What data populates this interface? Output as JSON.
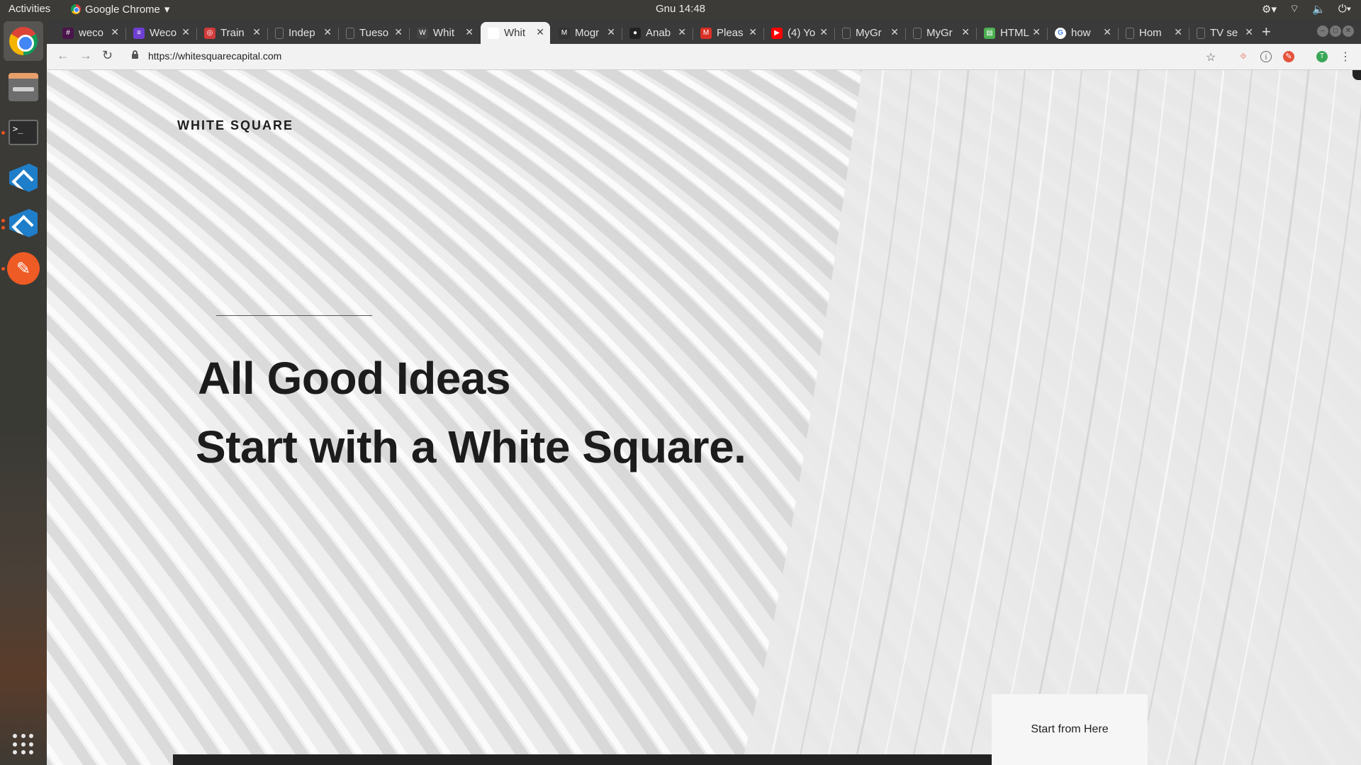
{
  "topbar": {
    "activities": "Activities",
    "app_name": "Google Chrome",
    "clock": "Gnu 14:48"
  },
  "dock": {
    "items": [
      "chrome",
      "files",
      "terminal",
      "vscode",
      "vscode",
      "postman"
    ]
  },
  "tabs": [
    {
      "title": "weco",
      "favicon": "slack",
      "color": "#4a154b"
    },
    {
      "title": "Weco",
      "favicon": "list",
      "color": "#6e3fd0"
    },
    {
      "title": "Train",
      "favicon": "pin",
      "color": "#d23b3b"
    },
    {
      "title": "Indep",
      "favicon": "blank",
      "color": "#555555"
    },
    {
      "title": "Tueso",
      "favicon": "blank",
      "color": "#555555"
    },
    {
      "title": "Whit",
      "favicon": "w",
      "color": "#444444"
    },
    {
      "title": "Whit",
      "favicon": "blank-white",
      "color": "#ffffff",
      "active": true
    },
    {
      "title": "Mogr",
      "favicon": "m",
      "color": "#333333"
    },
    {
      "title": "Anab",
      "favicon": "github",
      "color": "#222222"
    },
    {
      "title": "Pleas",
      "favicon": "gmail",
      "color": "#d93025"
    },
    {
      "title": "(4) Yo",
      "favicon": "youtube",
      "color": "#ff0000"
    },
    {
      "title": "MyGr",
      "favicon": "doc",
      "color": "#555555"
    },
    {
      "title": "MyGr",
      "favicon": "doc",
      "color": "#555555"
    },
    {
      "title": "HTML",
      "favicon": "chart",
      "color": "#4caf50"
    },
    {
      "title": "how",
      "favicon": "google",
      "color": "#4285f4"
    },
    {
      "title": "Hom",
      "favicon": "doc",
      "color": "#555555"
    },
    {
      "title": "TV se",
      "favicon": "doc",
      "color": "#555555"
    }
  ],
  "toolbar": {
    "url": "https://whitesquarecapital.com",
    "profile_initial": "T"
  },
  "page": {
    "logo": "WHITE SQUARE",
    "headline_1": "All Good Ideas",
    "headline_2": "Start with a White Square.",
    "cta": "Start from Here"
  }
}
